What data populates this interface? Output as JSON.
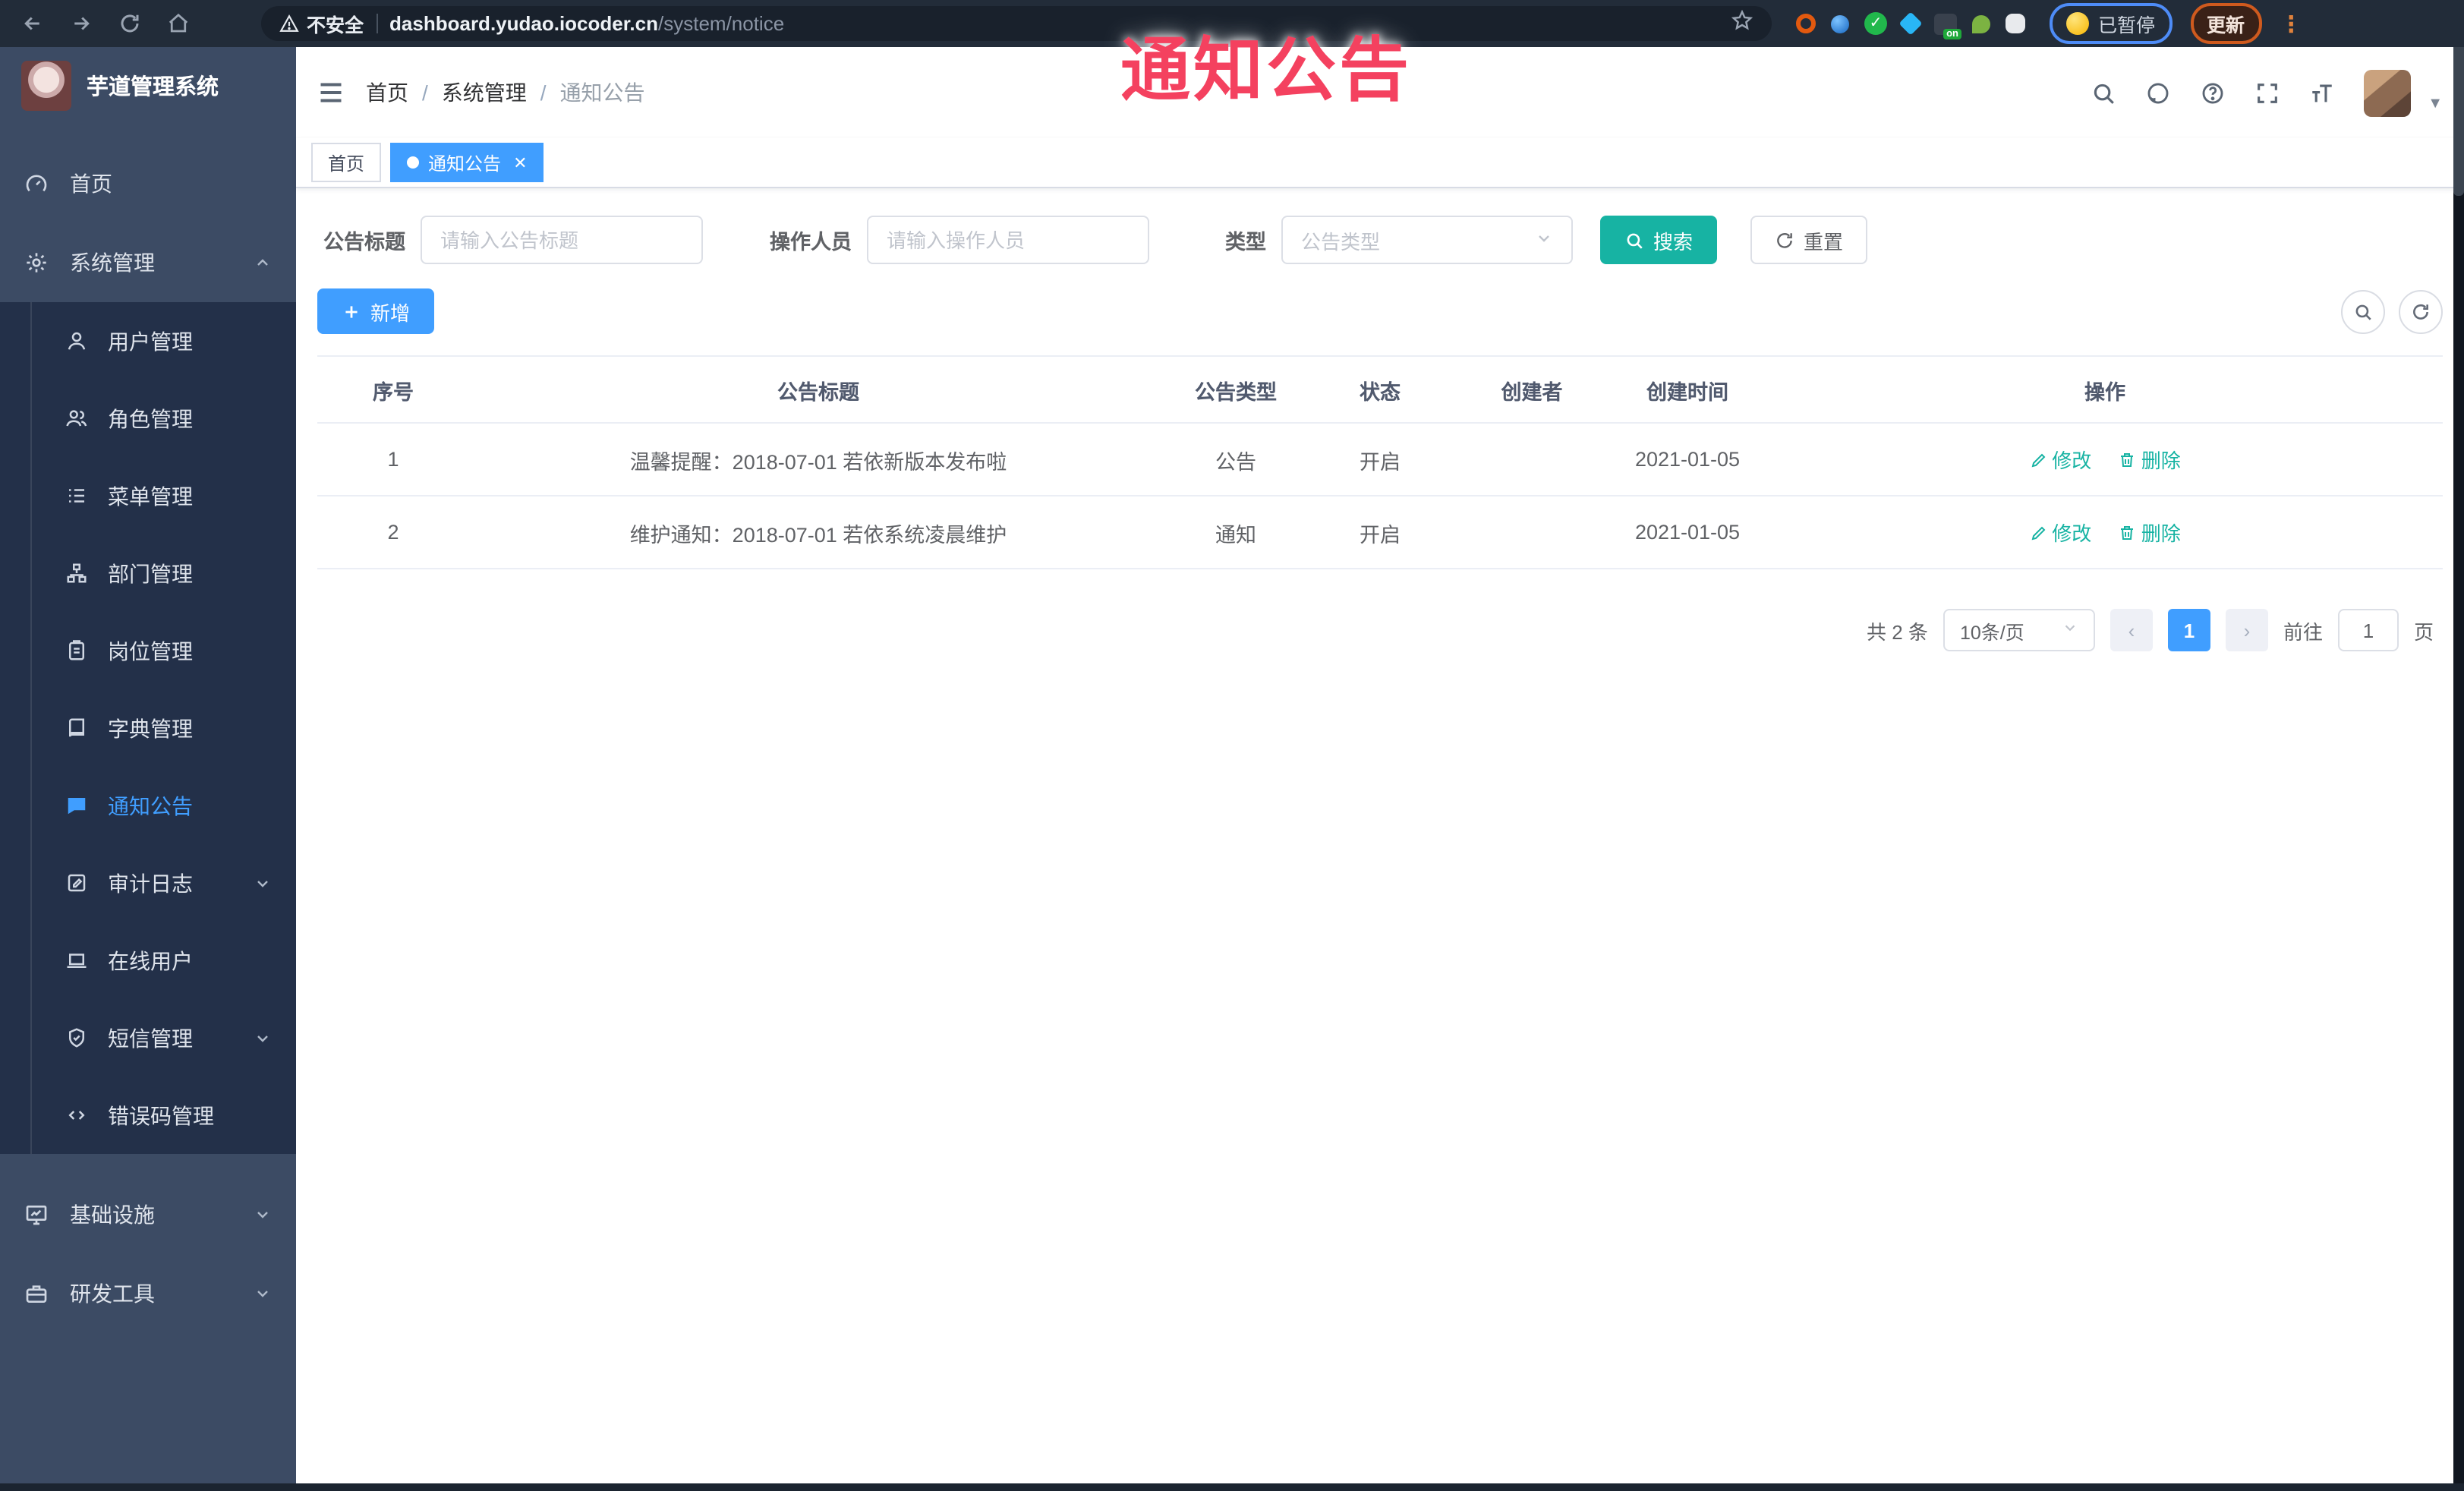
{
  "browser": {
    "security_label": "不安全",
    "url_host": "dashboard.yudao.iocoder.cn",
    "url_path": "/system/notice",
    "extension_on_badge": "on",
    "paused_label": "已暂停",
    "update_label": "更新"
  },
  "overlay": {
    "title": "通知公告"
  },
  "sidebar": {
    "title": "芋道管理系统",
    "items": [
      {
        "label": "首页"
      },
      {
        "label": "系统管理"
      },
      {
        "label": "基础设施"
      },
      {
        "label": "研发工具"
      }
    ],
    "submenu": [
      {
        "label": "用户管理"
      },
      {
        "label": "角色管理"
      },
      {
        "label": "菜单管理"
      },
      {
        "label": "部门管理"
      },
      {
        "label": "岗位管理"
      },
      {
        "label": "字典管理"
      },
      {
        "label": "通知公告"
      },
      {
        "label": "审计日志"
      },
      {
        "label": "在线用户"
      },
      {
        "label": "短信管理"
      },
      {
        "label": "错误码管理"
      }
    ]
  },
  "breadcrumb": {
    "items": [
      "首页",
      "系统管理",
      "通知公告"
    ]
  },
  "tabs": [
    {
      "label": "首页"
    },
    {
      "label": "通知公告"
    }
  ],
  "filters": {
    "title_label": "公告标题",
    "title_placeholder": "请输入公告标题",
    "operator_label": "操作人员",
    "operator_placeholder": "请输入操作人员",
    "type_label": "类型",
    "type_placeholder": "公告类型",
    "search_label": "搜索",
    "reset_label": "重置"
  },
  "toolbar": {
    "add_label": "新增"
  },
  "table": {
    "columns": [
      "序号",
      "公告标题",
      "公告类型",
      "状态",
      "创建者",
      "创建时间",
      "操作"
    ],
    "rows": [
      {
        "no": "1",
        "title": "温馨提醒：2018-07-01 若依新版本发布啦",
        "type": "公告",
        "status": "开启",
        "creator": "",
        "created": "2021-01-05",
        "edit": "修改",
        "delete": "删除"
      },
      {
        "no": "2",
        "title": "维护通知：2018-07-01 若依系统凌晨维护",
        "type": "通知",
        "status": "开启",
        "creator": "",
        "created": "2021-01-05",
        "edit": "修改",
        "delete": "删除"
      }
    ]
  },
  "pagination": {
    "total": "共 2 条",
    "page_size": "10条/页",
    "current": "1",
    "goto_label": "前往",
    "goto_value": "1",
    "page_label": "页"
  },
  "colors": {
    "primary": "#409eff",
    "teal_action": "#17b3a3",
    "overlay_red": "#f4415f",
    "sidebar_bg": "#3c4b64",
    "submenu_bg": "#233049",
    "chrome_bg": "#222c39"
  }
}
